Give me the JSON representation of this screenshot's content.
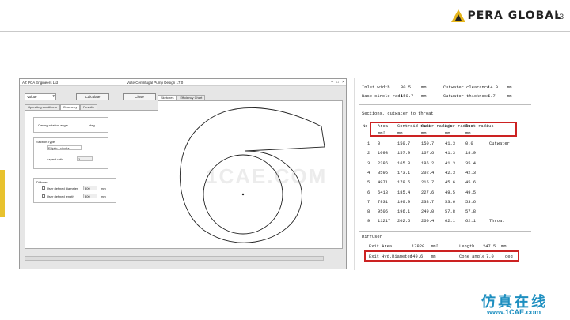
{
  "slide": {
    "brand": "PERA GLOBAL",
    "page_number": "13",
    "footer_brand": "仿真在线",
    "footer_url": "www.1CAE.com",
    "watermark": "1CAE.COM"
  },
  "app": {
    "app_name": "AZ  PCA Engineers Ltd",
    "window_title": "Volte Centrifugal Pump Design 17.0",
    "toolbar": {
      "dropdown_value": "Volute",
      "calculate_label": "Calculate",
      "close_label": "Close"
    },
    "left_tabs": [
      "Operating conditions",
      "Geometry",
      "Results"
    ],
    "right_tabs": [
      "Sketches",
      "Efficiency Chart"
    ],
    "form": {
      "cutwater_label": "Casing rotation angle",
      "cutwater_unit": "deg",
      "section_type_label": "Section Type",
      "section_type_value": "Elliptic / circula",
      "aspect_ratio_label": "Aspect ratio",
      "aspect_ratio_value": "1",
      "diffuser_label": "Diffuser",
      "diffuser_diameter_label": "User defined diameter",
      "diffuser_diameter_value": "300",
      "diffuser_diameter_unit": "mm",
      "diffuser_length_label": "User defined length",
      "diffuser_length_value": "300",
      "diffuser_length_unit": "mm"
    }
  },
  "results": {
    "inlet_width_label": "Inlet width",
    "inlet_width_value": "80.5",
    "inlet_width_unit": "mm",
    "cutwater_clearance_label": "Cutwater clearance",
    "cutwater_clearance_value": "14.0",
    "cutwater_clearance_unit": "mm",
    "base_circle_label": "Base circle radi",
    "base_circle_value": "150.7",
    "base_circle_unit": "mm",
    "cutwater_thickness_label": "Cutwater thickness",
    "cutwater_thickness_value": "5.7",
    "cutwater_thickness_unit": "mm",
    "sections_title": "Sections, cutwater to throat",
    "table_headers": [
      "No",
      "Area",
      "Centroid radi",
      "Outer radius",
      "Ajor radius",
      "Root radius"
    ],
    "table_units": [
      "mm²",
      "mm",
      "mm",
      "mm",
      "mm"
    ],
    "rows": [
      [
        "1",
        "0",
        "150.7",
        "150.7",
        "41.3",
        "0.0",
        "Cutwater"
      ],
      [
        "2",
        "1093",
        "157.9",
        "167.6",
        "41.3",
        "18.9",
        ""
      ],
      [
        "3",
        "2286",
        "165.8",
        "186.2",
        "41.3",
        "35.4",
        ""
      ],
      [
        "4",
        "3595",
        "173.1",
        "202.4",
        "42.3",
        "42.3",
        ""
      ],
      [
        "5",
        "4971",
        "179.5",
        "215.7",
        "45.6",
        "45.6",
        ""
      ],
      [
        "6",
        "6418",
        "185.4",
        "227.6",
        "49.5",
        "49.5",
        ""
      ],
      [
        "7",
        "7931",
        "190.9",
        "238.7",
        "53.6",
        "53.6",
        ""
      ],
      [
        "8",
        "9505",
        "196.1",
        "249.0",
        "57.8",
        "57.8",
        ""
      ],
      [
        "9",
        "11217",
        "202.5",
        "260.4",
        "62.1",
        "62.1",
        "Throat"
      ]
    ],
    "diffuser_title": "Diffuser",
    "exit_area_label": "Exit Area",
    "exit_area_value": "17820",
    "exit_area_unit": "mm²",
    "length_label": "Length",
    "length_value": "247.5",
    "length_unit": "mm",
    "exit_hyd_label": "Exit Hyd.Diameter",
    "exit_hyd_value": "149.6",
    "exit_hyd_unit": "mm",
    "cone_angle_label": "Cone angle",
    "cone_angle_value": "7.0",
    "cone_angle_unit": "deg"
  },
  "colors": {
    "accent_yellow": "#e8c22e",
    "highlight_red": "#cc2222",
    "footer_blue": "#1e8fc0"
  }
}
